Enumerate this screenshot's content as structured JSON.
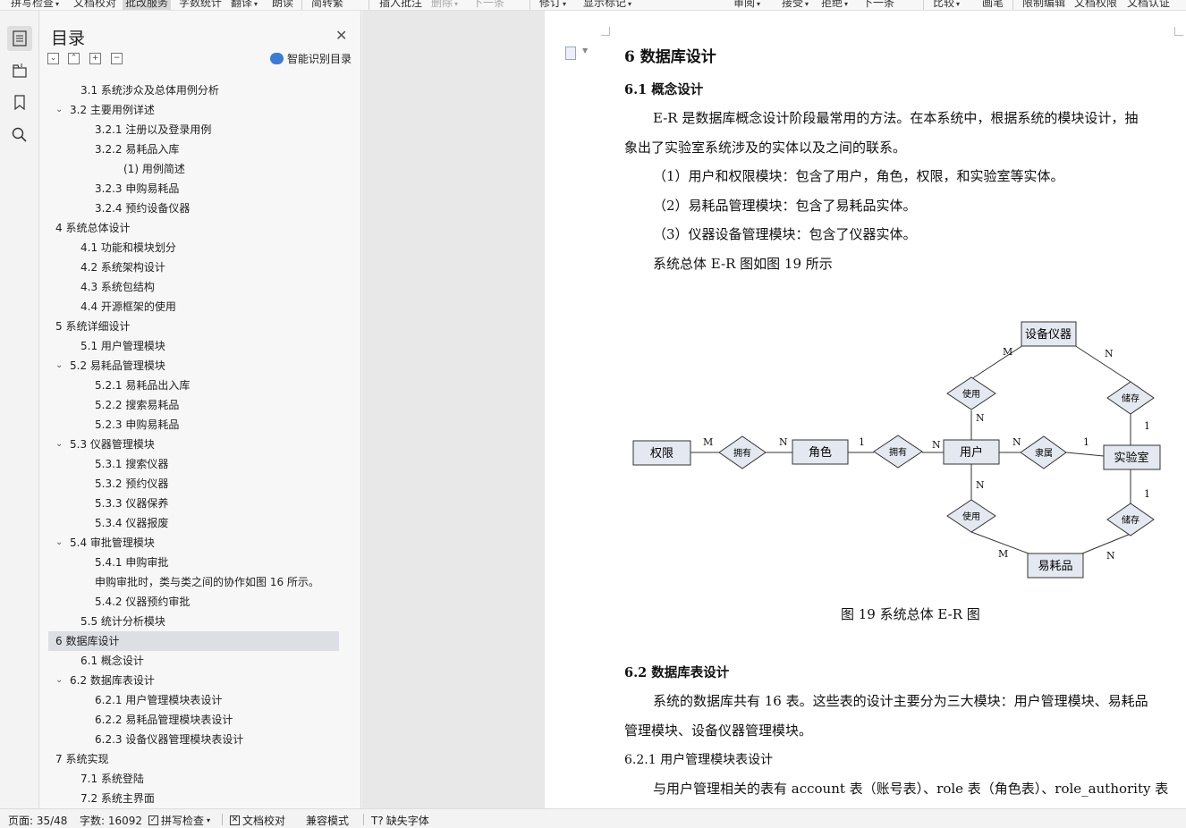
{
  "ribbon": {
    "items": [
      "拼写检查",
      "文档校对",
      "批改服务",
      "字数统计",
      "翻译",
      "朗读",
      "简转繁",
      "插入批注",
      "删除",
      "下一条",
      "修订",
      "显示标记",
      "审阅",
      "接受",
      "拒绝",
      "下一条",
      "比较",
      "画笔",
      "限制编辑",
      "文档权限",
      "文档认证"
    ]
  },
  "toc": {
    "title": "目录",
    "smart_label": "智能识别目录",
    "items": [
      {
        "label": "3.1  系统涉众及总体用例分析",
        "level": 2,
        "chevron": false
      },
      {
        "label": "3.2  主要用例详述",
        "level": 2,
        "chevron": true
      },
      {
        "label": "3.2.1  注册以及登录用例",
        "level": 3,
        "chevron": false
      },
      {
        "label": "3.2.2  易耗品入库",
        "level": 3,
        "chevron": false
      },
      {
        "label": "(1)  用例简述",
        "level": 4,
        "chevron": false
      },
      {
        "label": "3.2.3  申购易耗品",
        "level": 3,
        "chevron": false
      },
      {
        "label": "3.2.4  预约设备仪器",
        "level": 3,
        "chevron": false
      },
      {
        "label": "4  系统总体设计",
        "level": 1,
        "chevron": true
      },
      {
        "label": "4.1  功能和模块划分",
        "level": 2,
        "chevron": false
      },
      {
        "label": "4.2  系统架构设计",
        "level": 2,
        "chevron": false
      },
      {
        "label": "4.3  系统包结构",
        "level": 2,
        "chevron": false
      },
      {
        "label": "4.4  开源框架的使用",
        "level": 2,
        "chevron": false
      },
      {
        "label": "5  系统详细设计",
        "level": 1,
        "chevron": true
      },
      {
        "label": "5.1  用户管理模块",
        "level": 2,
        "chevron": false
      },
      {
        "label": "5.2  易耗品管理模块",
        "level": 2,
        "chevron": true
      },
      {
        "label": "5.2.1  易耗品出入库",
        "level": 3,
        "chevron": false
      },
      {
        "label": "5.2.2  搜索易耗品",
        "level": 3,
        "chevron": false
      },
      {
        "label": "5.2.3  申购易耗品",
        "level": 3,
        "chevron": false
      },
      {
        "label": "5.3  仪器管理模块",
        "level": 2,
        "chevron": true
      },
      {
        "label": "5.3.1  搜索仪器",
        "level": 3,
        "chevron": false
      },
      {
        "label": "5.3.2  预约仪器",
        "level": 3,
        "chevron": false
      },
      {
        "label": "5.3.3  仪器保养",
        "level": 3,
        "chevron": false
      },
      {
        "label": "5.3.4  仪器报废",
        "level": 3,
        "chevron": false
      },
      {
        "label": "5.4  审批管理模块",
        "level": 2,
        "chevron": true
      },
      {
        "label": "5.4.1  申购审批",
        "level": 3,
        "chevron": false
      },
      {
        "label": "申购审批时，类与类之间的协作如图 16 所示。",
        "level": 3,
        "chevron": false
      },
      {
        "label": "5.4.2  仪器预约审批",
        "level": 3,
        "chevron": false
      },
      {
        "label": "5.5  统计分析模块",
        "level": 2,
        "chevron": false
      },
      {
        "label": "6  数据库设计",
        "level": 1,
        "chevron": true,
        "selected": true
      },
      {
        "label": "6.1  概念设计",
        "level": 2,
        "chevron": false
      },
      {
        "label": "6.2  数据库表设计",
        "level": 2,
        "chevron": true
      },
      {
        "label": "6.2.1  用户管理模块表设计",
        "level": 3,
        "chevron": false
      },
      {
        "label": "6.2.2  易耗品管理模块表设计",
        "level": 3,
        "chevron": false
      },
      {
        "label": "6.2.3  设备仪器管理模块表设计",
        "level": 3,
        "chevron": false
      },
      {
        "label": "7  系统实现",
        "level": 1,
        "chevron": true
      },
      {
        "label": "7.1  系统登陆",
        "level": 2,
        "chevron": false
      },
      {
        "label": "7.2  系统主界面",
        "level": 2,
        "chevron": false
      }
    ]
  },
  "document": {
    "h1": "6  数据库设计",
    "h2_concept": "6.1  概念设计",
    "p1_line1": "E-R 是数据库概念设计阶段最常用的方法。在本系统中，根据系统的模块设计，抽",
    "p1_line2": "象出了实验室系统涉及的实体以及之间的联系。",
    "p2": "（1）用户和权限模块：包含了用户，角色，权限，和实验室等实体。",
    "p3": "（2）易耗品管理模块：包含了易耗品实体。",
    "p4": "（3）仪器设备管理模块：包含了仪器实体。",
    "p5": "系统总体 E-R 图如图 19 所示",
    "caption": "图 19  系统总体 E-R 图",
    "h2_tables": "6.2  数据库表设计",
    "p6_line1": "系统的数据库共有 16 表。这些表的设计主要分为三大模块：用户管理模块、易耗品",
    "p6_line2": "管理模块、设备仪器管理模块。",
    "h3": "6.2.1  用户管理模块表设计",
    "p7": "与用户管理相关的表有 account 表（账号表）、role 表（角色表）、role_authority 表"
  },
  "er": {
    "entities": {
      "quanxian": "权限",
      "juese": "角色",
      "yonghu": "用户",
      "shiyanshi": "实验室",
      "shebei": "设备仪器",
      "yihaopin": "易耗品"
    },
    "relations": {
      "yongyou1": "拥有",
      "yongyou2": "拥有",
      "lishu": "隶属",
      "shiyong1": "使用",
      "chucun1": "储存",
      "shiyong2": "使用",
      "chucun2": "储存"
    },
    "cardinalities": {
      "c1": "M",
      "c2": "N",
      "c3": "1",
      "c4": "N",
      "c5": "N",
      "c6": "1",
      "c7": "M",
      "c8": "N",
      "c9": "N",
      "c10": "1",
      "c11": "N",
      "c12": "1",
      "c13": "M",
      "c14": "N"
    }
  },
  "status": {
    "page": "页面: 35/48",
    "words": "字数: 16092",
    "spell": "拼写检查",
    "proof": "文档校对",
    "compat": "兼容模式",
    "missing_font": "缺失字体"
  }
}
